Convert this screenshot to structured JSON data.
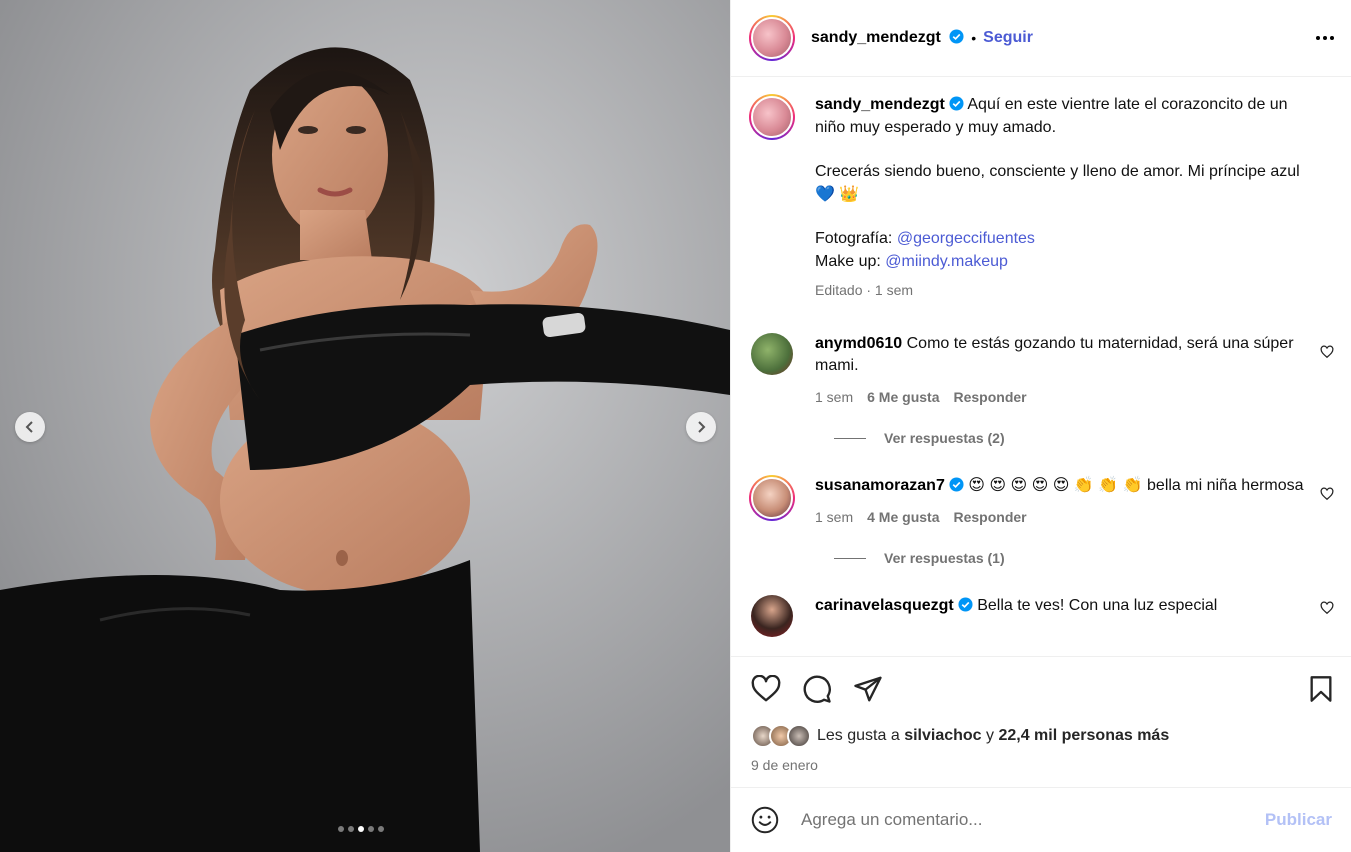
{
  "header": {
    "username": "sandy_mendezgt",
    "separator": "•",
    "follow_label": "Seguir"
  },
  "caption": {
    "username": "sandy_mendezgt",
    "line1": "Aquí en este vientre late el corazoncito de un niño muy esperado y muy amado.",
    "line2": "Crecerás siendo bueno, consciente y lleno de amor. Mi príncipe azul 💙 👑",
    "photo_label": "Fotografía:",
    "photo_handle": "@georgeccifuentes",
    "makeup_label": "Make up:",
    "makeup_handle": "@miindy.makeup",
    "meta": "Editado · 1 sem"
  },
  "comments": [
    {
      "username": "anymd0610",
      "text": "Como te estás gozando tu maternidad, será una súper mami.",
      "time": "1 sem",
      "likes": "6 Me gusta",
      "reply": "Responder",
      "view_replies": "Ver respuestas (2)"
    },
    {
      "username": "susanamorazan7",
      "text": "😍 😍 😍 😍 😍 👏 👏 👏 bella mi niña hermosa",
      "time": "1 sem",
      "likes": "4 Me gusta",
      "reply": "Responder",
      "view_replies": "Ver respuestas (1)"
    },
    {
      "username": "carinavelasquezgt",
      "text": "Bella te ves! Con una luz especial"
    }
  ],
  "likes": {
    "prefix": "Les gusta a",
    "user": "silviachoc",
    "conj": "y",
    "others": "22,4 mil personas más"
  },
  "date": "9 de enero",
  "comment_box": {
    "placeholder": "Agrega un comentario...",
    "publish_label": "Publicar"
  },
  "carousel": {
    "count": 5,
    "active_index": 2
  },
  "colors": {
    "link": "#4c5bd4",
    "verified": "#0095f6",
    "muted": "#737373",
    "publish_disabled": "#b3c1f6"
  },
  "icons": [
    "chevron-left-icon",
    "chevron-right-icon",
    "more-icon",
    "verified-icon",
    "heart-icon",
    "comment-icon",
    "share-icon",
    "save-icon",
    "emoji-icon"
  ]
}
